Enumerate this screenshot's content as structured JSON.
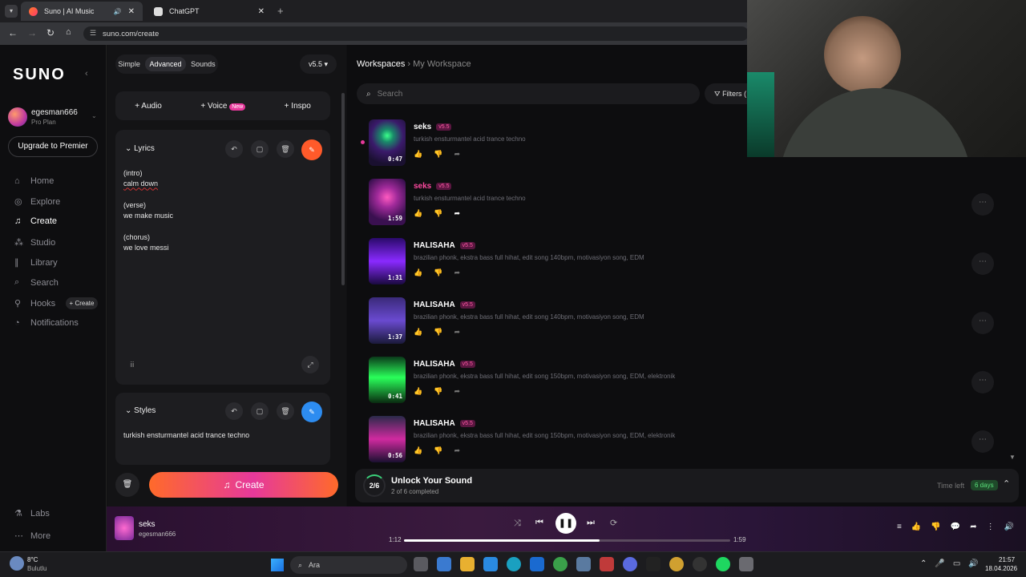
{
  "browser": {
    "tabs": [
      {
        "label": "Suno | AI Music"
      },
      {
        "label": "ChatGPT"
      }
    ],
    "url": "suno.com/create"
  },
  "sidebar": {
    "logo": "SUNO",
    "username": "egesman666",
    "plan": "Pro Plan",
    "upgrade": "Upgrade to Premier",
    "nav": [
      {
        "label": "Home",
        "icon": "home-icon"
      },
      {
        "label": "Explore",
        "icon": "compass-icon"
      },
      {
        "label": "Create",
        "icon": "music-note-icon"
      },
      {
        "label": "Studio",
        "icon": "studio-icon"
      },
      {
        "label": "Library",
        "icon": "library-icon"
      },
      {
        "label": "Search",
        "icon": "search-icon"
      },
      {
        "label": "Hooks",
        "icon": "hook-icon"
      },
      {
        "label": "Notifications",
        "icon": "bell-icon"
      }
    ],
    "hooks_create": "+ Create",
    "labs": "Labs",
    "more": "More"
  },
  "create": {
    "modes": [
      "Simple",
      "Advanced",
      "Sounds"
    ],
    "version": "v5.5",
    "add_audio": "Audio",
    "add_voice": "Voice",
    "voice_badge": "New",
    "add_inspo": "Inspo",
    "lyrics_label": "Lyrics",
    "lyrics_lines": [
      "(intro)",
      "calm down",
      "",
      "(verse)",
      "we make music",
      "",
      "(chorus)",
      "we love messi"
    ],
    "styles_label": "Styles",
    "styles_value": "turkish ensturmantel acid trance techno",
    "create_button": "Create"
  },
  "workspace": {
    "root": "Workspaces",
    "current": "My Workspace",
    "search_placeholder": "Search",
    "filters": "Filters ("
  },
  "songs": [
    {
      "title": "seks",
      "version": "v5.5",
      "desc": "turkish ensturmantel acid trance techno",
      "duration": "0:47"
    },
    {
      "title": "seks",
      "version": "v5.5",
      "desc": "turkish ensturmantel acid trance techno",
      "duration": "1:59"
    },
    {
      "title": "HALISAHA",
      "version": "v5.5",
      "desc": "brazilian phonk, ekstra bass full hihat, edit song 140bpm, motivasiyon song, EDM",
      "duration": "1:31"
    },
    {
      "title": "HALISAHA",
      "version": "v5.5",
      "desc": "brazilian phonk, ekstra bass full hihat, edit song 140bpm, motivasiyon song, EDM",
      "duration": "1:37"
    },
    {
      "title": "HALISAHA",
      "version": "v5.5",
      "desc": "brazilian phonk, ekstra bass full hihat, edit song 150bpm, motivasiyon song, EDM, elektronik",
      "duration": "0:41"
    },
    {
      "title": "HALISAHA",
      "version": "v5.5",
      "desc": "brazilian phonk, ekstra bass full hihat, edit song 150bpm, motivasiyon song, EDM, elektronik",
      "duration": "0:56"
    }
  ],
  "unlock": {
    "progress": "2/6",
    "title": "Unlock Your Sound",
    "sub": "2 of 6 completed",
    "time_label": "Time left",
    "time_value": "6 days"
  },
  "player": {
    "title": "seks",
    "artist": "egesman666",
    "elapsed": "1:12",
    "total": "1:59",
    "progress": 0.6
  },
  "taskbar": {
    "temp": "8°C",
    "weather": "Bulutlu",
    "search": "Ara",
    "time": "21:57",
    "date": "18.04.2026"
  },
  "colors": {
    "accent_orange": "#ff5a2a",
    "accent_pink": "#e6399b",
    "accent_blue": "#2d8cf0",
    "badge_green": "#1f7a3a"
  }
}
